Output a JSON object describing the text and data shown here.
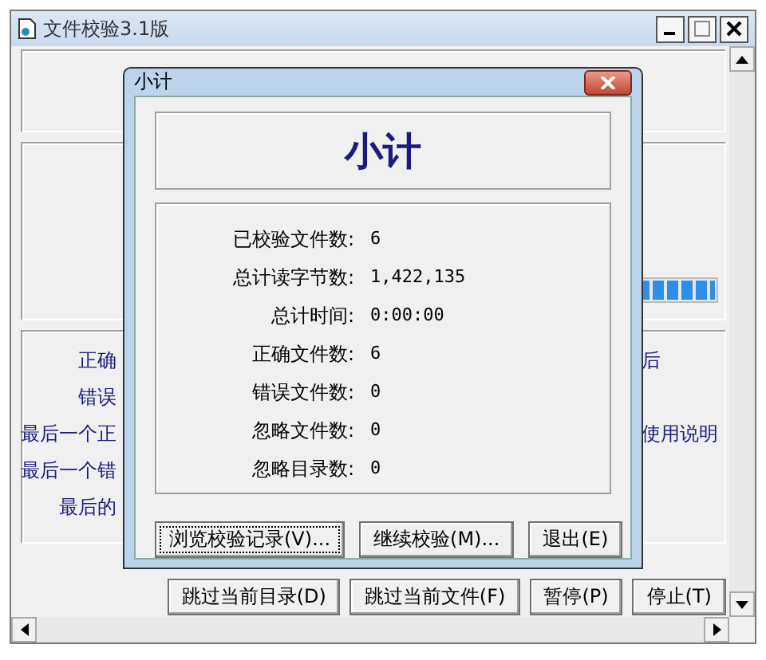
{
  "window": {
    "title": "文件校验3.1版",
    "progress": {
      "level": 1
    },
    "labels": [
      "正确",
      "错误",
      "最后一个正",
      "最后一个错",
      "最后的"
    ],
    "side_labels": [
      "后",
      "使用说明"
    ],
    "buttons": [
      {
        "label": "跳过当前目录(D)"
      },
      {
        "label": "跳过当前文件(F)"
      },
      {
        "label": "暂停(P)"
      },
      {
        "label": "停止(T)"
      }
    ]
  },
  "dialog": {
    "title": "小计",
    "heading": "小计",
    "stats": [
      {
        "label": "已校验文件数:",
        "value": "6"
      },
      {
        "label": "总计读字节数:",
        "value": "1,422,135"
      },
      {
        "label": "总计时间:",
        "value": "0:00:00"
      },
      {
        "label": "正确文件数:",
        "value": "6"
      },
      {
        "label": "错误文件数:",
        "value": "0"
      },
      {
        "label": "忽略文件数:",
        "value": "0"
      },
      {
        "label": "忽略目录数:",
        "value": "0"
      }
    ],
    "buttons": [
      {
        "label": "浏览校验记录(V)...",
        "focused": true
      },
      {
        "label": "继续校验(M)...",
        "focused": false
      },
      {
        "label": "退出(E)",
        "focused": false
      }
    ]
  }
}
